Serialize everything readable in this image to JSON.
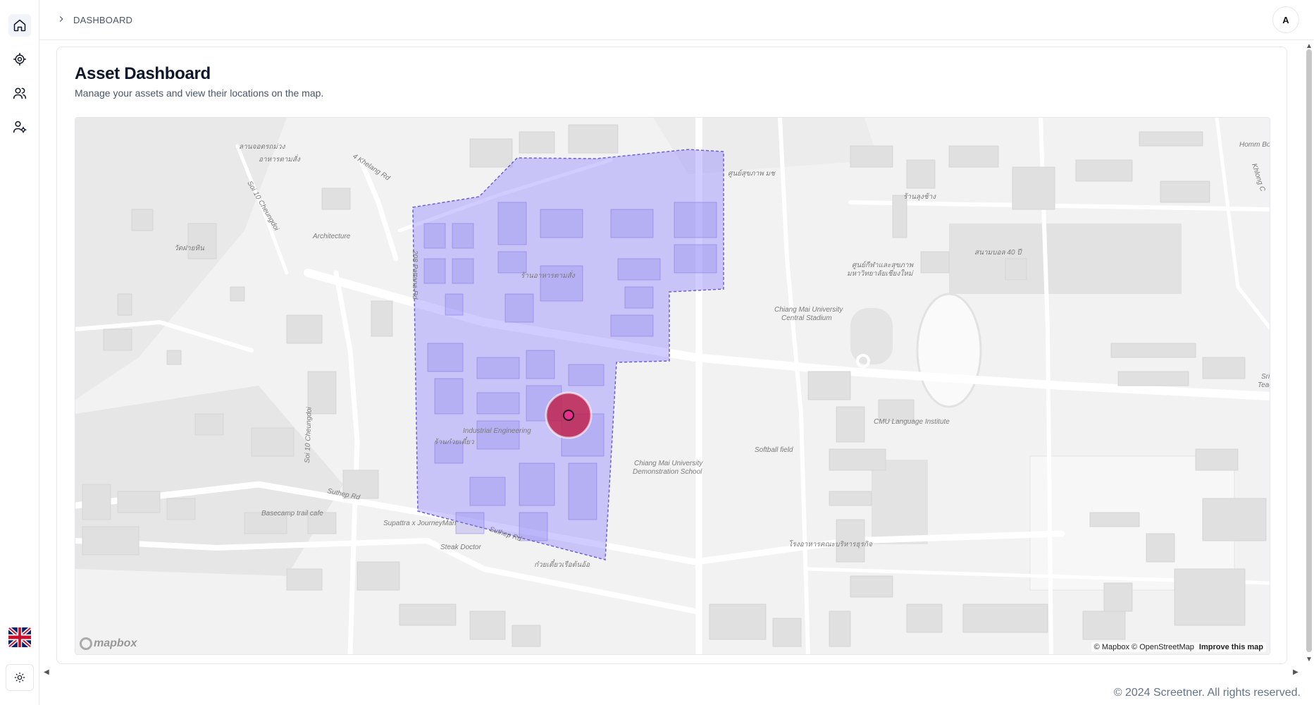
{
  "breadcrumb": {
    "label": "DASHBOARD"
  },
  "user": {
    "avatar_initial": "A"
  },
  "page": {
    "title": "Asset Dashboard",
    "subtitle": "Manage your assets and view their locations on the map."
  },
  "map": {
    "labels": [
      {
        "text": "ลานจอดรถม่วง"
      },
      {
        "text": "อาหารตามสั่ง"
      },
      {
        "text": "4 Khelang Rd"
      },
      {
        "text": "Soi 10 Cheungdoi"
      },
      {
        "text": "Architecture"
      },
      {
        "text": "วัดฝายหิน"
      },
      {
        "text": "ร้านอาหารตามสั่ง"
      },
      {
        "text": "208 Pattana Rd"
      },
      {
        "text": "Industrial Engineering"
      },
      {
        "text": "ร้านก๋วยเตี๋ยว"
      },
      {
        "text": "Soi 10 Cheungdoi"
      },
      {
        "text": "Suthep Rd"
      },
      {
        "text": "Basecamp trail cafe"
      },
      {
        "text": "Supattra x JourneyMan"
      },
      {
        "text": "Suthep Rd"
      },
      {
        "text": "Steak Doctor"
      },
      {
        "text": "ก๋วยเตี๋ยวเรือต้นอ้อ"
      },
      {
        "text": "ศูนย์สุขภาพ มช"
      },
      {
        "text": "ร้านลุงช้าง"
      },
      {
        "text": "ศูนย์กีฬาและสุขภาพ"
      },
      {
        "text": "มหาวิทยาลัยเชียงใหม่"
      },
      {
        "text": "สนามบอล 40 ปี"
      },
      {
        "text": "Chiang Mai University"
      },
      {
        "text": "Central Stadium"
      },
      {
        "text": "CMU Language Institute"
      },
      {
        "text": "Softball field"
      },
      {
        "text": "Chiang Mai University"
      },
      {
        "text": "Demonstration School"
      },
      {
        "text": "โรงอาหารคณะบริหารธุรกิจ"
      },
      {
        "text": "Homm Bo"
      },
      {
        "text": "Khlong C"
      },
      {
        "text": "Sri"
      },
      {
        "text": "Teac"
      }
    ],
    "logo_text": "mapbox",
    "attribution": {
      "mapbox": "© Mapbox",
      "osm": "© OpenStreetMap",
      "improve": "Improve this map"
    },
    "geofence_color": "#8b80ff",
    "marker_color": "#c0244f"
  },
  "footer": {
    "copyright": "© 2024 Screetner. All rights reserved."
  }
}
